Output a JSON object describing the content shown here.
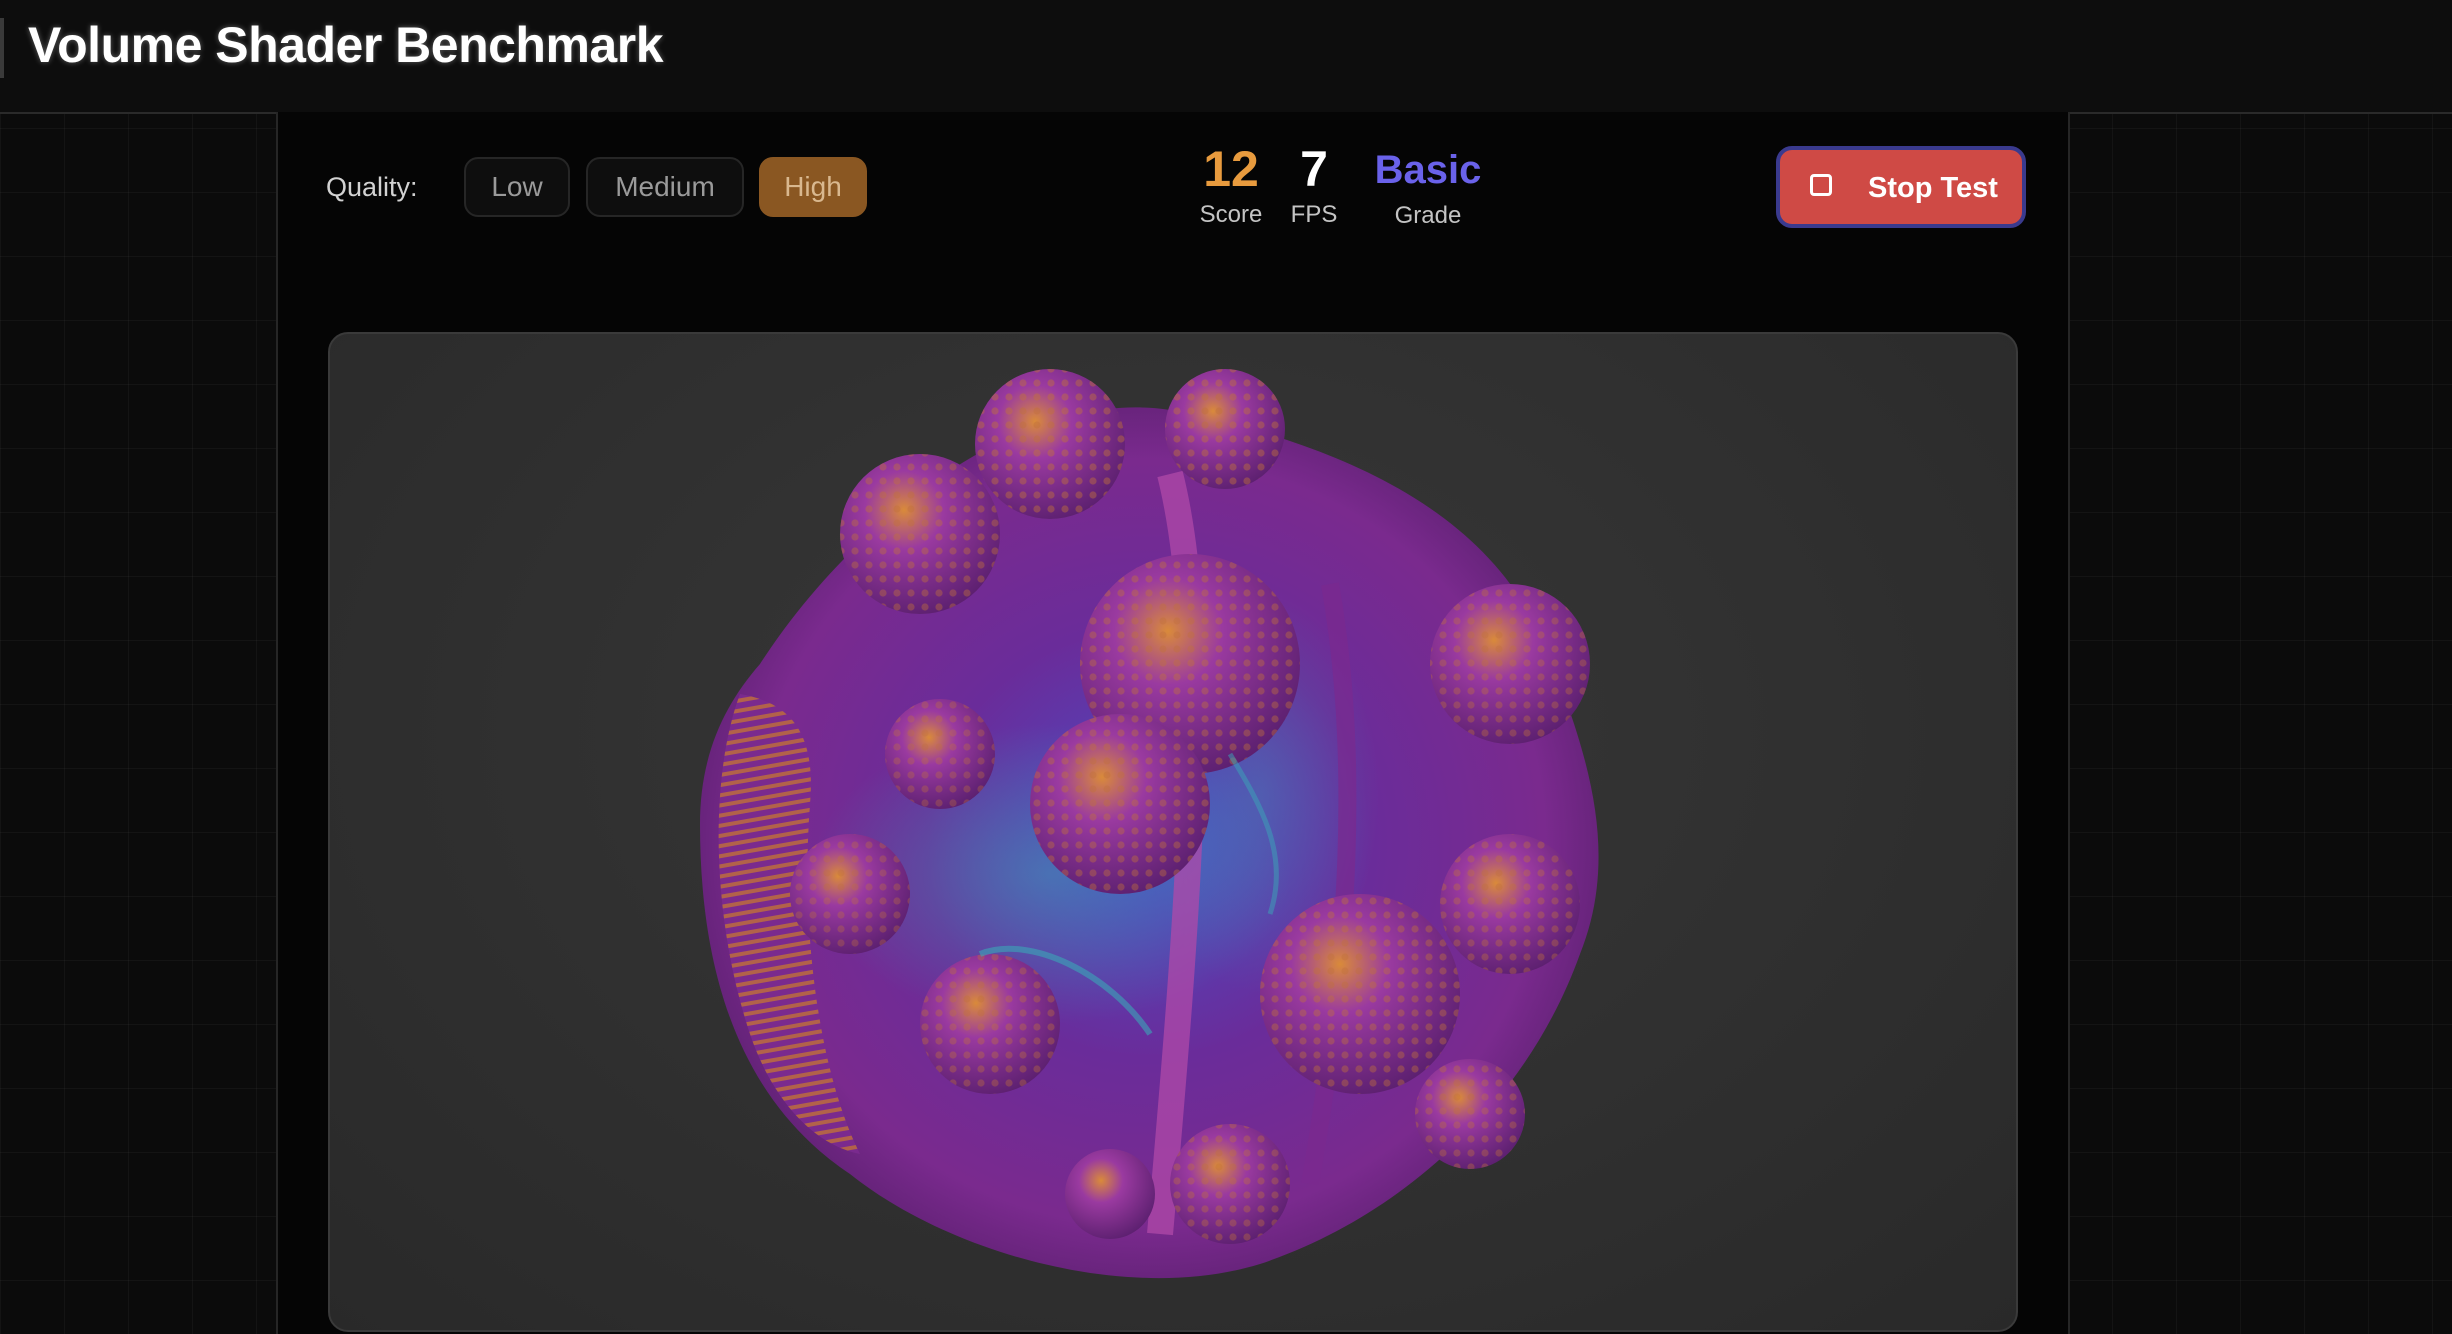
{
  "header": {
    "title": "Volume Shader Benchmark"
  },
  "controls": {
    "quality_label": "Quality:",
    "quality_options": [
      "Low",
      "Medium",
      "High"
    ],
    "selected_quality": "High"
  },
  "stats": {
    "score": {
      "value": "12",
      "label": "Score"
    },
    "fps": {
      "value": "7",
      "label": "FPS"
    },
    "grade": {
      "value": "Basic",
      "label": "Grade"
    }
  },
  "actions": {
    "stop_label": "Stop Test",
    "stop_icon": "stop-square-icon"
  },
  "render": {
    "subject": "volumetric-fractal",
    "colors": {
      "primary": "#7a2a8e",
      "secondary": "#4a4cc4",
      "highlight": "#d98a3a",
      "teal": "#3aa6b8"
    }
  },
  "theme": {
    "accent_orange": "#e89b3e",
    "accent_purple": "#6a62ea",
    "stop_red": "#cf4a45",
    "background": "#0b0b0b"
  }
}
